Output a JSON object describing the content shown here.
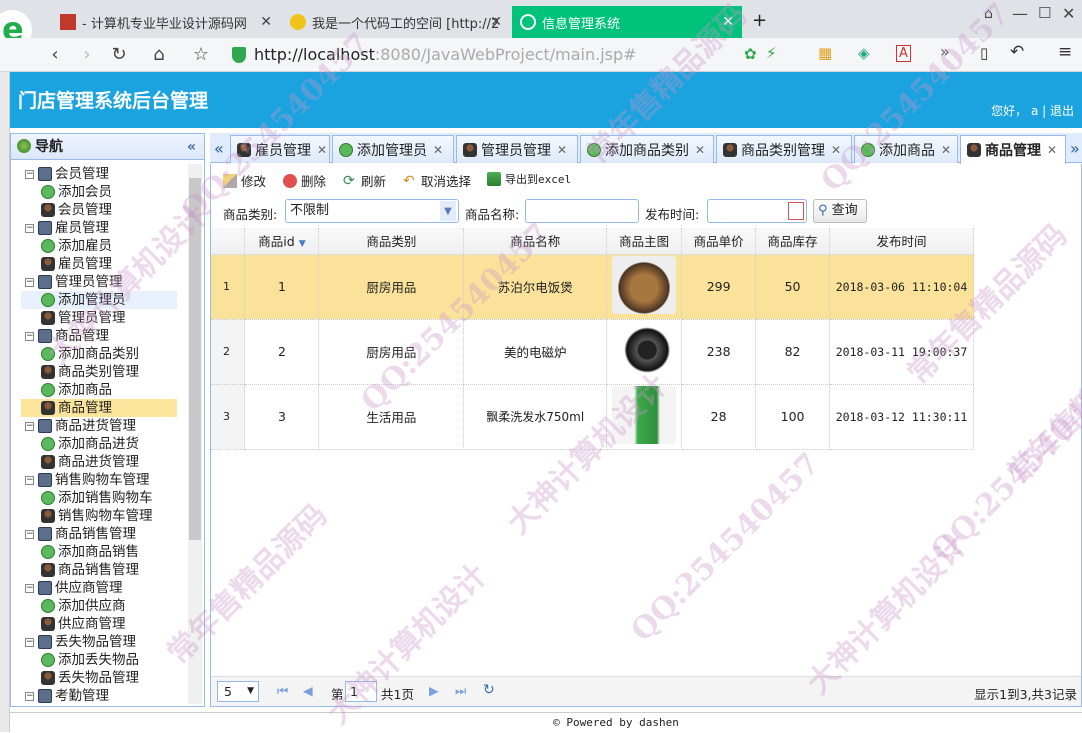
{
  "browser": {
    "tabs": [
      {
        "title": "- 计算机专业毕业设计源码网"
      },
      {
        "title": "我是一个代码工的空间 [http://2"
      },
      {
        "title": "信息管理系统"
      }
    ],
    "new_tab": "+",
    "url_host": "http://localhost",
    "url_rest": ":8080/JavaWebProject/main.jsp#"
  },
  "header": {
    "title": "门店管理系统后台管理",
    "greeting": "您好， a | 退出"
  },
  "nav": {
    "title": "导航",
    "collapse": "«",
    "items": [
      {
        "label": "会员管理",
        "type": "group"
      },
      {
        "label": "添加会员",
        "type": "add"
      },
      {
        "label": "会员管理",
        "type": "user"
      },
      {
        "label": "雇员管理",
        "type": "group"
      },
      {
        "label": "添加雇员",
        "type": "add"
      },
      {
        "label": "雇员管理",
        "type": "user"
      },
      {
        "label": "管理员管理",
        "type": "group"
      },
      {
        "label": "添加管理员",
        "type": "add"
      },
      {
        "label": "管理员管理",
        "type": "user"
      },
      {
        "label": "商品管理",
        "type": "group"
      },
      {
        "label": "添加商品类别",
        "type": "add"
      },
      {
        "label": "商品类别管理",
        "type": "user"
      },
      {
        "label": "添加商品",
        "type": "add"
      },
      {
        "label": "商品管理",
        "type": "user"
      },
      {
        "label": "商品进货管理",
        "type": "group"
      },
      {
        "label": "添加商品进货",
        "type": "add"
      },
      {
        "label": "商品进货管理",
        "type": "user"
      },
      {
        "label": "销售购物车管理",
        "type": "group"
      },
      {
        "label": "添加销售购物车",
        "type": "add"
      },
      {
        "label": "销售购物车管理",
        "type": "user"
      },
      {
        "label": "商品销售管理",
        "type": "group"
      },
      {
        "label": "添加商品销售",
        "type": "add"
      },
      {
        "label": "商品销售管理",
        "type": "user"
      },
      {
        "label": "供应商管理",
        "type": "group"
      },
      {
        "label": "添加供应商",
        "type": "add"
      },
      {
        "label": "供应商管理",
        "type": "user"
      },
      {
        "label": "丢失物品管理",
        "type": "group"
      },
      {
        "label": "添加丢失物品",
        "type": "add"
      },
      {
        "label": "丢失物品管理",
        "type": "user"
      },
      {
        "label": "考勤管理",
        "type": "group"
      }
    ]
  },
  "tabs": [
    {
      "label": "雇员管理",
      "icon": "user"
    },
    {
      "label": "添加管理员",
      "icon": "add"
    },
    {
      "label": "管理员管理",
      "icon": "user"
    },
    {
      "label": "添加商品类别",
      "icon": "add"
    },
    {
      "label": "商品类别管理",
      "icon": "user"
    },
    {
      "label": "添加商品",
      "icon": "add"
    },
    {
      "label": "商品管理",
      "icon": "user"
    }
  ],
  "toolbar": {
    "edit": "修改",
    "delete": "删除",
    "refresh": "刷新",
    "unselect": "取消选择",
    "export": "导出到excel"
  },
  "filter": {
    "category_label": "商品类别:",
    "category_value": "不限制",
    "name_label": "商品名称:",
    "name_value": "",
    "date_label": "发布时间:",
    "date_value": "",
    "query": "查询"
  },
  "grid": {
    "columns": [
      "商品id",
      "商品类别",
      "商品名称",
      "商品主图",
      "商品单价",
      "商品库存",
      "发布时间"
    ],
    "rows": [
      {
        "rn": "1",
        "id": "1",
        "category": "厨房用品",
        "name": "苏泊尔电饭煲",
        "price": "299",
        "stock": "50",
        "date": "2018-03-06 11:10:04"
      },
      {
        "rn": "2",
        "id": "2",
        "category": "厨房用品",
        "name": "美的电磁炉",
        "price": "238",
        "stock": "82",
        "date": "2018-03-11 19:00:37"
      },
      {
        "rn": "3",
        "id": "3",
        "category": "生活用品",
        "name": "飘柔洗发水750ml",
        "price": "28",
        "stock": "100",
        "date": "2018-03-12 11:30:11"
      }
    ]
  },
  "pager": {
    "page_size": "5",
    "page_prefix": "第",
    "page_value": "1",
    "page_total": "共1页",
    "summary": "显示1到3,共3记录"
  },
  "footer": "© Powered by dashen",
  "watermarks": [
    "QQ:254540457",
    "常年售精品源码",
    "大神计算机设计"
  ]
}
